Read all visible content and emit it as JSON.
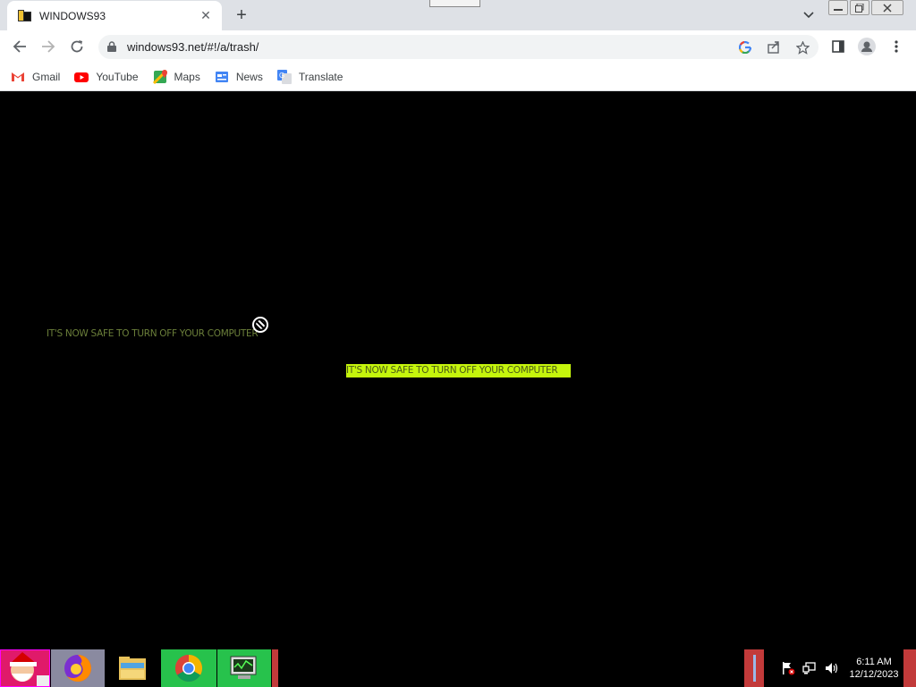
{
  "browser": {
    "tab_title": "WINDOWS93",
    "url": "windows93.net/#!/a/trash/"
  },
  "bookmarks": [
    {
      "label": "Gmail",
      "icon": "gmail-icon"
    },
    {
      "label": "YouTube",
      "icon": "youtube-icon"
    },
    {
      "label": "Maps",
      "icon": "maps-icon"
    },
    {
      "label": "News",
      "icon": "news-icon"
    },
    {
      "label": "Translate",
      "icon": "translate-icon"
    }
  ],
  "page": {
    "message_dim": "IT'S NOW SAFE TO TURN OFF YOUR COMPUTER",
    "message_highlight": "IT'S NOW SAFE TO TURN OFF YOUR COMPUTER",
    "highlight_color": "#c5f50c",
    "dim_color": "#6b7f3a"
  },
  "taskbar": {
    "apps": [
      "santa-app-icon",
      "firefox-icon",
      "file-explorer-icon",
      "chrome-icon",
      "system-monitor-icon"
    ],
    "clock_time": "6:11 AM",
    "clock_date": "12/12/2023"
  }
}
